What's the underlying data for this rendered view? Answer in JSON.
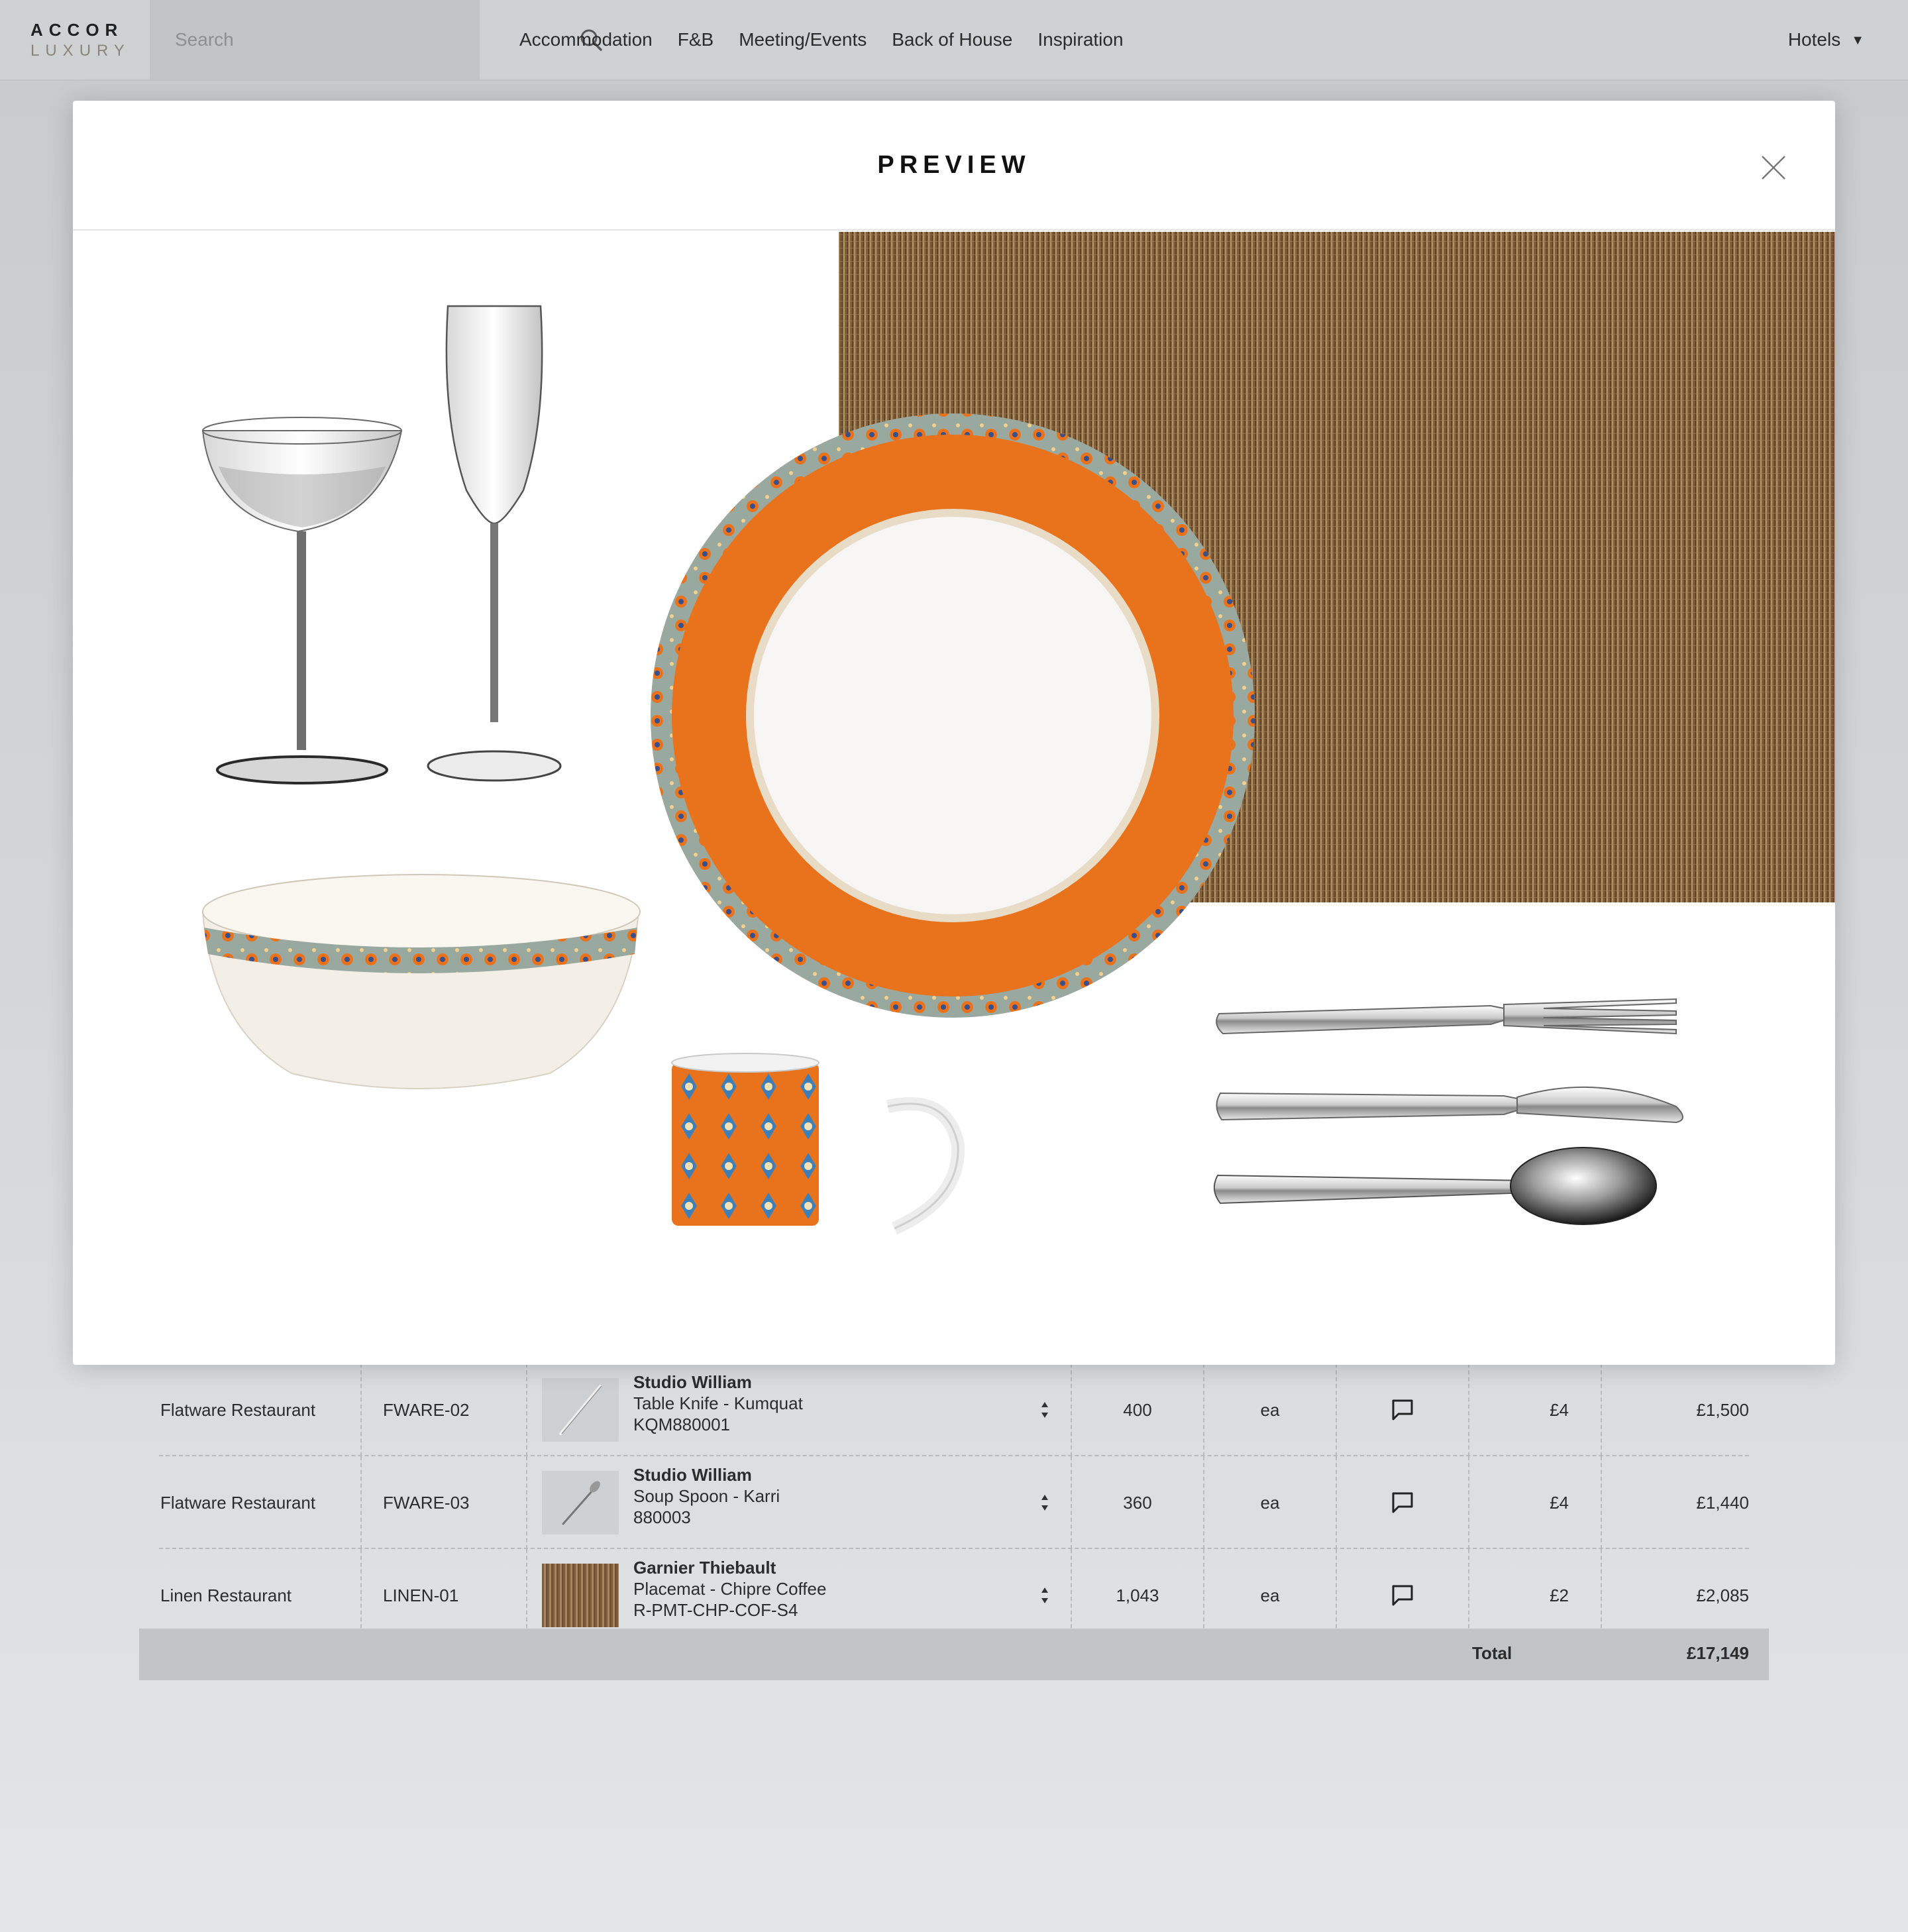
{
  "brand": {
    "line1": "ACCOR",
    "line2": "LUXURY"
  },
  "search": {
    "placeholder": "Search"
  },
  "nav": {
    "items": [
      "Accommodation",
      "F&B",
      "Meeting/Events",
      "Back of House",
      "Inspiration"
    ],
    "hotels_label": "Hotels"
  },
  "modal": {
    "title": "PREVIEW",
    "items": [
      "coupe-glass",
      "champagne-flute",
      "salad-bowl",
      "dinner-plate",
      "placemat",
      "mug",
      "fork",
      "knife",
      "spoon"
    ]
  },
  "table": {
    "rows": [
      {
        "category": "Flatware Restaurant",
        "code": "FWARE-02",
        "brand": "Studio William",
        "name": "Table Knife - Kumquat",
        "sku": "KQM880001",
        "qty": "400",
        "unit": "ea",
        "price": "£4",
        "total": "£1,500"
      },
      {
        "category": "Flatware Restaurant",
        "code": "FWARE-03",
        "brand": "Studio William",
        "name": "Soup Spoon - Karri",
        "sku": "880003",
        "qty": "360",
        "unit": "ea",
        "price": "£4",
        "total": "£1,440"
      },
      {
        "category": "Linen Restaurant",
        "code": "LINEN-01",
        "brand": "Garnier Thiebault",
        "name": "Placemat - Chipre Coffee",
        "sku": "R-PMT-CHP-COF-S4",
        "qty": "1,043",
        "unit": "ea",
        "price": "£2",
        "total": "£2,085"
      }
    ],
    "total_label": "Total",
    "total_value": "£17,149"
  },
  "colors": {
    "accent_orange": "#e8731c",
    "placemat": "#8a6844",
    "bg": "#d0d1d2"
  }
}
